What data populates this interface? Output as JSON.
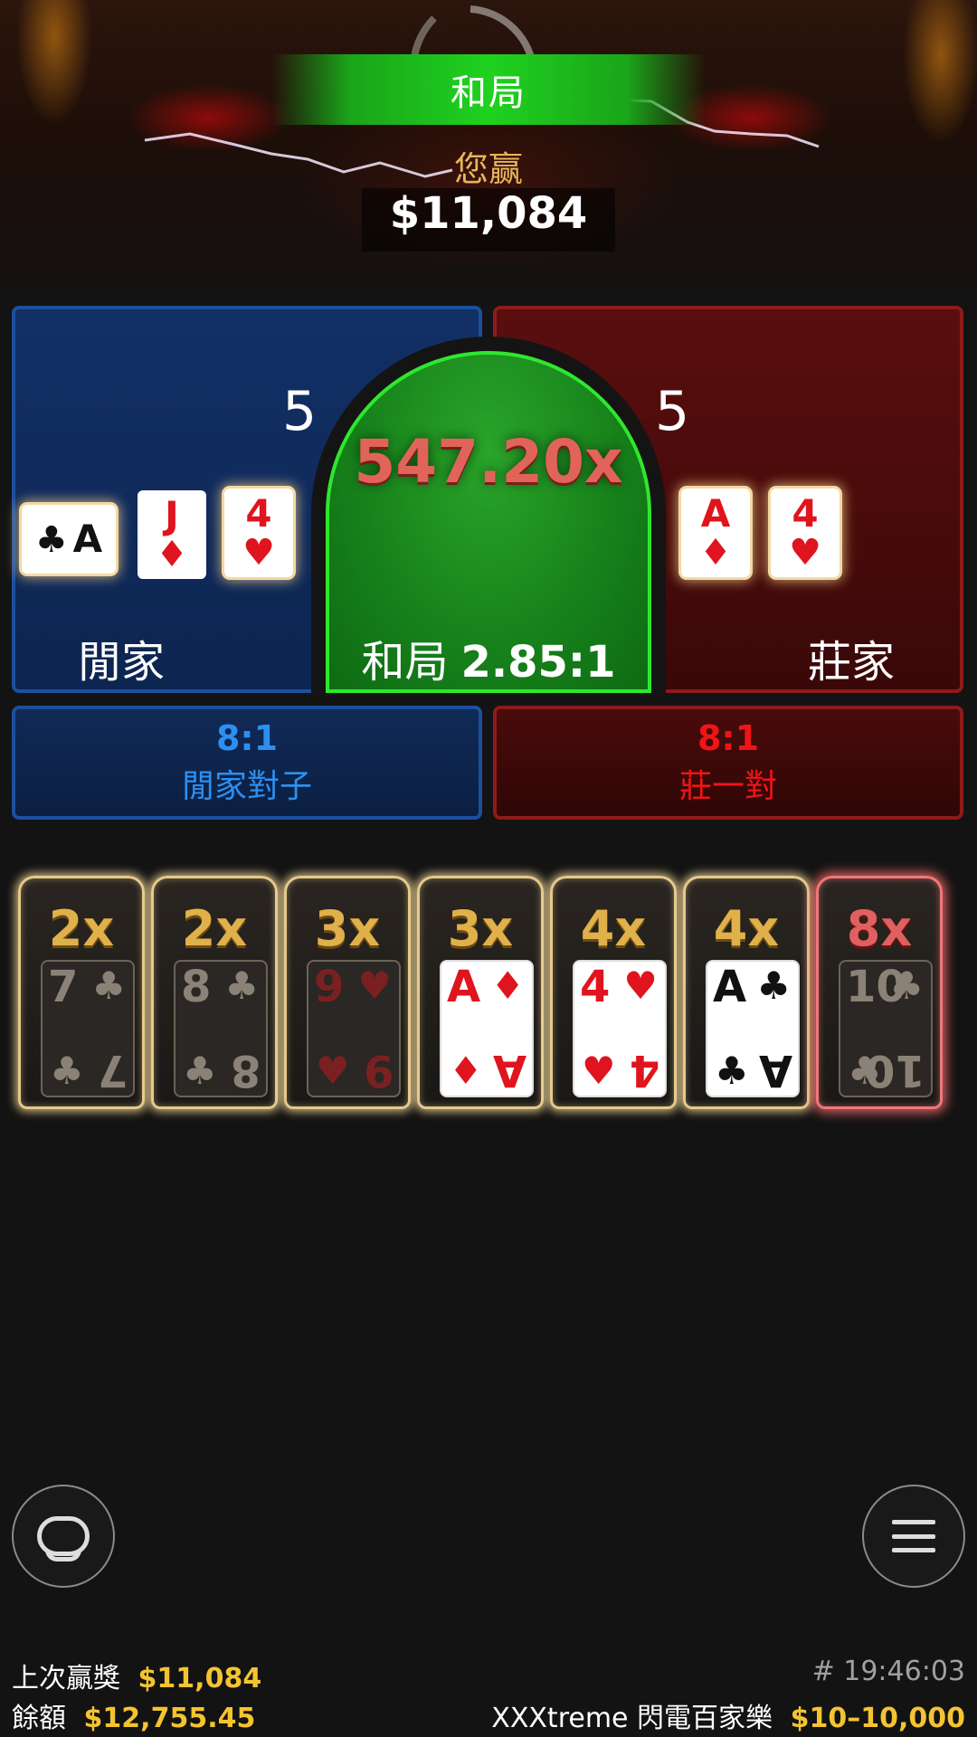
{
  "result": {
    "banner": "和局",
    "win_label": "您赢",
    "win_amount": "$11,084"
  },
  "table": {
    "player": {
      "score": "5",
      "label": "閒家",
      "cards": [
        {
          "rank": "A",
          "suit": "♣",
          "color": "black",
          "sideways": true
        },
        {
          "rank": "J",
          "suit": "♦",
          "color": "red",
          "sideways": false
        },
        {
          "rank": "4",
          "suit": "♥",
          "color": "red",
          "sideways": false
        }
      ]
    },
    "banker": {
      "score": "5",
      "label": "莊家",
      "cards": [
        {
          "rank": "A",
          "suit": "♦",
          "color": "red"
        },
        {
          "rank": "4",
          "suit": "♥",
          "color": "red"
        }
      ]
    },
    "tie": {
      "multiplier": "547.20x",
      "label": "和局",
      "payout": "2.85:1"
    },
    "player_pair": {
      "odds": "8:1",
      "label": "閒家對子"
    },
    "banker_pair": {
      "odds": "8:1",
      "label": "莊一對"
    }
  },
  "lightning_cards": [
    {
      "mult": "2x",
      "rank": "7",
      "suit": "♣",
      "style": "dim",
      "hot": false
    },
    {
      "mult": "2x",
      "rank": "8",
      "suit": "♣",
      "style": "dim",
      "hot": false
    },
    {
      "mult": "3x",
      "rank": "9",
      "suit": "♥",
      "style": "dim-red",
      "hot": false
    },
    {
      "mult": "3x",
      "rank": "A",
      "suit": "♦",
      "style": "white-red",
      "hot": false
    },
    {
      "mult": "4x",
      "rank": "4",
      "suit": "♥",
      "style": "white-red",
      "hot": false
    },
    {
      "mult": "4x",
      "rank": "A",
      "suit": "♣",
      "style": "white-black",
      "hot": false
    },
    {
      "mult": "8x",
      "rank": "10",
      "suit": "♣",
      "style": "dim",
      "hot": true
    }
  ],
  "footer": {
    "last_win_label": "上次贏獎",
    "last_win_value": "$11,084",
    "balance_label": "餘額",
    "balance_value": "$12,755.45",
    "round_id": "# 19:46:03",
    "game_name": "XXXtreme 閃電百家樂",
    "limits": "$10–10,000"
  },
  "icons": {
    "chat": "chat-bubble-icon",
    "menu": "hamburger-menu-icon"
  },
  "colors": {
    "player": "#123066",
    "banker": "#5a0e0e",
    "tie": "#16801a",
    "gold": "#f4c430"
  }
}
